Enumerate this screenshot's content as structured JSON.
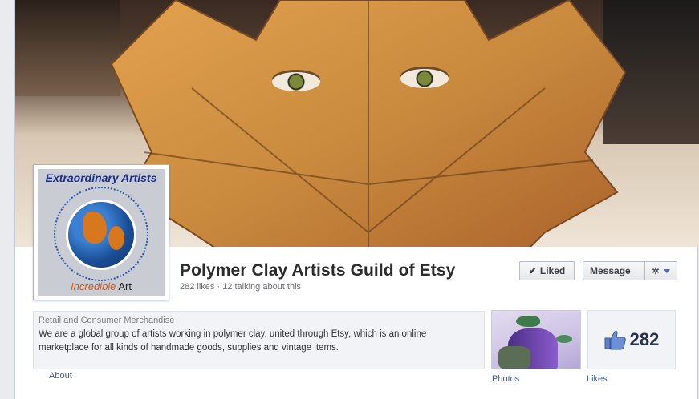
{
  "page": {
    "name": "Polymer Clay Artists Guild of Etsy",
    "stats": "282 likes · 12 talking about this"
  },
  "profile_pic": {
    "top_text": "Extraordinary Artists",
    "bottom_text_a": "Incredible",
    "bottom_text_b": " Art"
  },
  "actions": {
    "liked_label": "Liked",
    "message_label": "Message"
  },
  "about": {
    "category": "Retail and Consumer Merchandise",
    "description": "We are a global group of artists working in polymer clay, united through Etsy, which is an online marketplace for all kinds of handmade goods, supplies and vintage items.",
    "link_label": "About"
  },
  "apps": {
    "photos_label": "Photos",
    "likes_label": "Likes",
    "likes_count": "282"
  },
  "colors": {
    "link": "#3b5998",
    "title": "#2b2b2b"
  }
}
